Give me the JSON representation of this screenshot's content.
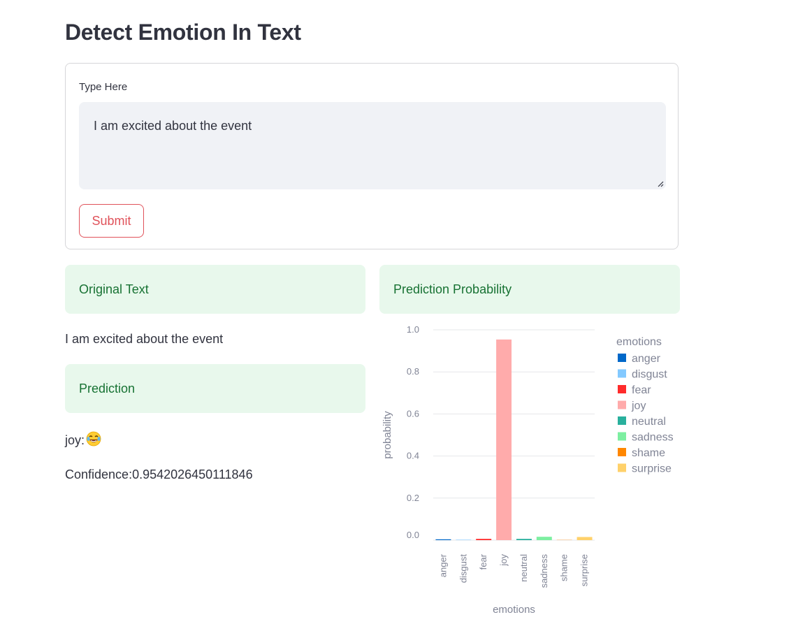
{
  "page": {
    "title": "Detect Emotion In Text"
  },
  "form": {
    "input_label": "Type Here",
    "input_value": "I am excited about the event",
    "submit_label": "Submit"
  },
  "results": {
    "original_text_header": "Original Text",
    "original_text": "I am excited about the event",
    "prediction_header": "Prediction",
    "prediction_label": "joy:",
    "prediction_emoji": "face-with-tears-of-joy-icon",
    "confidence_text": "Confidence:0.9542026450111846",
    "probability_header": "Prediction Probability"
  },
  "chart_data": {
    "type": "bar",
    "xlabel": "emotions",
    "ylabel": "probability",
    "ylim": [
      0,
      1.0
    ],
    "yticks": [
      "0.0",
      "0.2",
      "0.4",
      "0.6",
      "0.8",
      "1.0"
    ],
    "grid": true,
    "legend_title": "emotions",
    "legend_placement": "right",
    "categories": [
      "anger",
      "disgust",
      "fear",
      "joy",
      "neutral",
      "sadness",
      "shame",
      "surprise"
    ],
    "values": [
      0.004,
      0.002,
      0.006,
      0.954,
      0.006,
      0.016,
      0.001,
      0.015
    ],
    "colors": [
      "#0068c9",
      "#83c9ff",
      "#ff2b2b",
      "#ffabab",
      "#29b09d",
      "#7defa1",
      "#ff8700",
      "#ffd16a"
    ]
  }
}
